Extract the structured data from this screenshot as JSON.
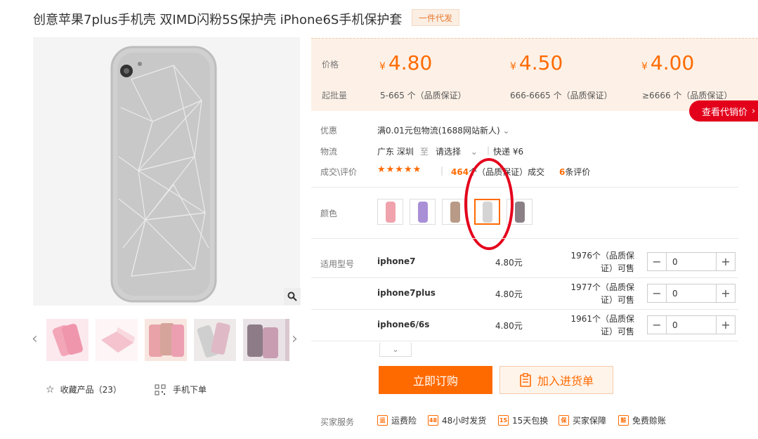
{
  "product": {
    "title": "创意苹果7plus手机壳 双IMD闪粉5S保护壳 iPhone6S手机保护套",
    "badge": "一件代发"
  },
  "gallery": {
    "favorites_label": "收藏产品（23）",
    "mobile_order_label": "手机下单"
  },
  "pricing": {
    "price_label": "价格",
    "moq_label": "起批量",
    "currency": "¥",
    "tiers": [
      {
        "price": "4.80",
        "range": "5-665 个（品质保证）"
      },
      {
        "price": "4.50",
        "range": "666-6665 个（品质保证）"
      },
      {
        "price": "4.00",
        "range": "≥6666 个（品质保证）"
      }
    ],
    "agent_price_button": "查看代销价"
  },
  "info": {
    "promo_label": "优惠",
    "promo_value": "满0.01元包物流(1688网站新人)",
    "logistics_label": "物流",
    "ship_from": "广东 深圳",
    "to": "至",
    "select": "请选择",
    "express": "快递 ¥6",
    "deals_label": "成交\\评价",
    "stars": "★★★★★",
    "deal_count": "464",
    "deal_suffix": "个（品质保证）成交",
    "review_count": "6",
    "review_suffix": "条评价"
  },
  "color": {
    "label": "颜色",
    "swatches": [
      "#f0a3ac",
      "#a98fd6",
      "#b89a86",
      "#d4d4d4",
      "#8a8086"
    ],
    "selected_index": 3
  },
  "models": {
    "label": "适用型号",
    "rows": [
      {
        "name": "iphone7",
        "price": "4.80元",
        "stock_line1": "1976个（品质保",
        "stock_line2": "证）可售",
        "qty": "0"
      },
      {
        "name": "iphone7plus",
        "price": "4.80元",
        "stock_line1": "1977个（品质保",
        "stock_line2": "证）可售",
        "qty": "0"
      },
      {
        "name": "iphone6/6s",
        "price": "4.80元",
        "stock_line1": "1961个（品质保",
        "stock_line2": "证）可售",
        "qty": "0"
      }
    ]
  },
  "actions": {
    "buy_now": "立即订购",
    "add_to_list": "加入进货单"
  },
  "services": {
    "label": "买家服务",
    "items": [
      "运费险",
      "48小时发货",
      "15天包换",
      "买家保障",
      "免费赊账"
    ]
  },
  "colors": {
    "accent": "#ff6a00",
    "highlight_circle": "#e5001b"
  }
}
